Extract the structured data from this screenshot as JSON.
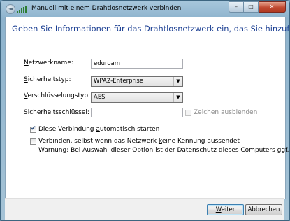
{
  "window": {
    "title": "Manuell mit einem Drahtlosnetzwerk verbinden",
    "minimize_symbol": "–",
    "maximize_symbol": "□",
    "close_symbol": "✕",
    "back_symbol": "◄"
  },
  "heading": "Geben Sie Informationen für das Drahtlosnetzwerk ein, das Sie hinzufügen möchten.",
  "form": {
    "network_name": {
      "label_underlined": "N",
      "label_rest": "etzwerkname:",
      "value": "eduroam"
    },
    "security_type": {
      "label_underlined": "S",
      "label_rest": "icherheitstyp:",
      "value": "WPA2-Enterprise"
    },
    "encryption_type": {
      "label_underlined": "V",
      "label_rest": "erschlüsselungstyp:",
      "value": "AES"
    },
    "security_key": {
      "label_pre": "S",
      "label_underlined": "i",
      "label_rest": "cherheitsschlüssel:",
      "value": ""
    },
    "show_chars": {
      "pre": "Zeichen ",
      "underlined": "a",
      "rest": "usblenden",
      "checked": false,
      "enabled": false
    }
  },
  "options": {
    "auto_start": {
      "pre": "Diese Verbindung ",
      "underlined": "a",
      "rest": "utomatisch starten",
      "checked": true
    },
    "hidden_network": {
      "pre": "Verbinden, selbst wenn das Netzwerk ",
      "underlined": "k",
      "rest": "eine Kennung aussendet",
      "checked": false
    },
    "warning": "Warnung: Bei Auswahl dieser Option ist der Datenschutz dieses Computers ggf. gefährdet."
  },
  "buttons": {
    "next": {
      "underlined": "W",
      "rest": "eiter"
    },
    "cancel": "Abbrechen"
  },
  "colors": {
    "heading": "#1a3e92",
    "wifi_bars": "#2e7d32",
    "close_button": "#c14a31"
  }
}
